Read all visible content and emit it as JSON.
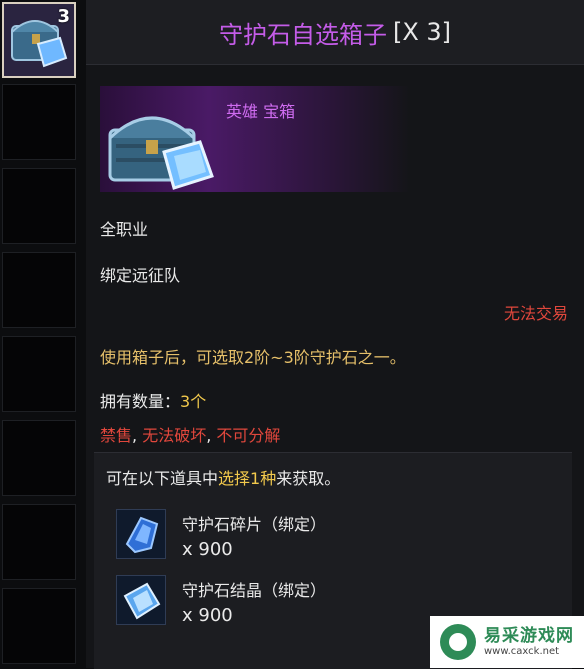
{
  "inventory": {
    "active_count": "3"
  },
  "tooltip": {
    "title": "守护石自选箱子",
    "quantity_tag": "[X 3]",
    "banner_label": "英雄 宝箱",
    "class_restriction": "全职业",
    "bind_type": "绑定远征队",
    "trade_status": "无法交易",
    "description": "使用箱子后，可选取2阶~3阶守护石之一。",
    "owned_label": "拥有数量：",
    "owned_value": "3个",
    "restrictions": [
      "禁售",
      "无法破坏",
      "不可分解"
    ],
    "restriction_sep": ", ",
    "choice_prefix": "可在以下道具中",
    "choice_highlight": "选择1种",
    "choice_suffix": "来获取。",
    "rewards": [
      {
        "name": "守护石碎片（绑定）",
        "qty": "x 900",
        "icon": "shard-icon"
      },
      {
        "name": "守护石结晶（绑定）",
        "qty": "x 900",
        "icon": "crystal-icon"
      }
    ]
  },
  "watermark": {
    "name": "易采游戏网",
    "url": "www.caxck.net"
  },
  "colors": {
    "title": "#c45ce8",
    "red": "#e0473c",
    "gold": "#e6c06a",
    "accent_yellow": "#f2c94c"
  }
}
